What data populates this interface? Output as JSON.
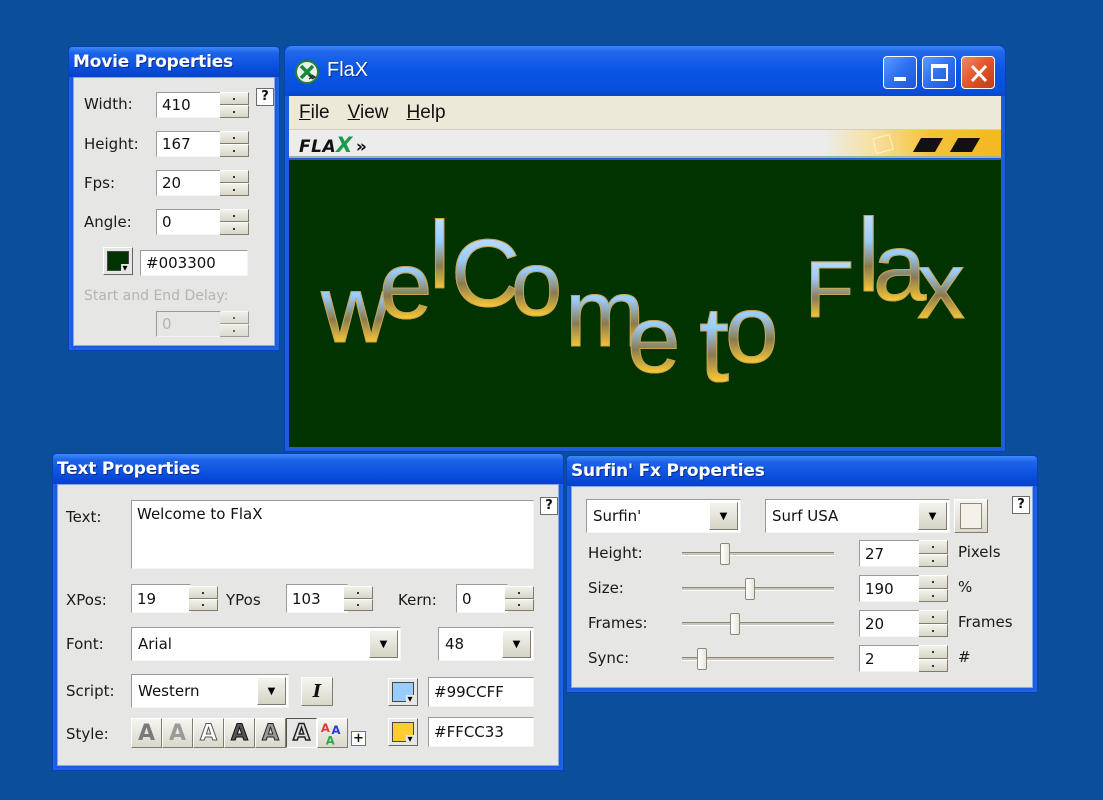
{
  "movie_properties": {
    "title": "Movie Properties",
    "help_label": "?",
    "width_label": "Width:",
    "width_value": "410",
    "height_label": "Height:",
    "height_value": "167",
    "fps_label": "Fps:",
    "fps_value": "20",
    "angle_label": "Angle:",
    "angle_value": "0",
    "bg_color_value": "#003300",
    "bg_color": "#003300",
    "delay_label": "Start and End Delay:",
    "delay_value": "0"
  },
  "flax_window": {
    "title": "FlaX",
    "app_icon": "flax-logo-icon",
    "caption_buttons": [
      "minimize",
      "maximize",
      "close"
    ],
    "menu": [
      {
        "label": "File",
        "accel": "F",
        "rest": "ile"
      },
      {
        "label": "View",
        "accel": "V",
        "rest": "iew"
      },
      {
        "label": "Help",
        "accel": "H",
        "rest": "elp"
      }
    ],
    "banner_logo": {
      "prefix": "FLA",
      "x": "X",
      "suffix": "»"
    },
    "stage": {
      "background": "#003300",
      "text": "Welcome to FlaX",
      "letters": [
        "w",
        "e",
        "l",
        "C",
        "o",
        "m",
        "e",
        "t",
        "o",
        "F",
        "l",
        "a",
        "x"
      ]
    }
  },
  "text_properties": {
    "title": "Text Properties",
    "help_label": "?",
    "text_label": "Text:",
    "text_value": "Welcome to FlaX",
    "xpos_label": "XPos:",
    "xpos_value": "19",
    "ypos_label": "YPos",
    "ypos_value": "103",
    "kern_label": "Kern:",
    "kern_value": "0",
    "font_label": "Font:",
    "font_value": "Arial",
    "size_value": "48",
    "script_label": "Script:",
    "script_value": "Western",
    "italic_label": "I",
    "color1_value": "#99CCFF",
    "color1": "#99CCFF",
    "color2_value": "#FFCC33",
    "color2": "#FFCC33",
    "style_label": "Style:",
    "style_buttons": [
      "solid",
      "gradient",
      "outline",
      "bold-outline",
      "bevel",
      "double-outline",
      "multicolor"
    ],
    "style_glyph": "A",
    "selected_style": "double-outline",
    "add_style_label": "+"
  },
  "surfin_properties": {
    "title": "Surfin' Fx Properties",
    "help_label": "?",
    "effect_value": "Surfin'",
    "preset_value": "Surf USA",
    "rows": [
      {
        "label": "Height:",
        "value": "27",
        "unit": "Pixels",
        "slider_fraction": 0.28
      },
      {
        "label": "Size:",
        "value": "190",
        "unit": "%",
        "slider_fraction": 0.45
      },
      {
        "label": "Frames:",
        "value": "20",
        "unit": "Frames",
        "slider_fraction": 0.35
      },
      {
        "label": "Sync:",
        "value": "2",
        "unit": "#",
        "slider_fraction": 0.13
      }
    ]
  }
}
